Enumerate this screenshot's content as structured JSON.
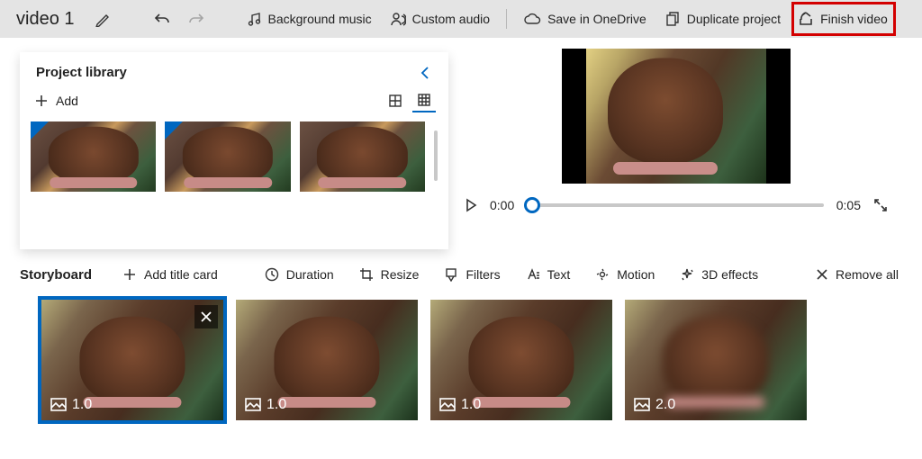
{
  "header": {
    "title": "video 1",
    "bg_music": "Background music",
    "custom_audio": "Custom audio",
    "save_onedrive": "Save in OneDrive",
    "duplicate": "Duplicate project",
    "finish": "Finish video"
  },
  "library": {
    "title": "Project library",
    "add": "Add"
  },
  "player": {
    "current": "0:00",
    "total": "0:05"
  },
  "storyboard": {
    "title": "Storyboard",
    "add_title_card": "Add title card",
    "duration": "Duration",
    "resize": "Resize",
    "filters": "Filters",
    "text": "Text",
    "motion": "Motion",
    "effects": "3D effects",
    "remove_all": "Remove all",
    "clips": [
      {
        "duration": "1.0",
        "selected": true,
        "blur": false
      },
      {
        "duration": "1.0",
        "selected": false,
        "blur": false
      },
      {
        "duration": "1.0",
        "selected": false,
        "blur": false
      },
      {
        "duration": "2.0",
        "selected": false,
        "blur": true
      }
    ]
  }
}
